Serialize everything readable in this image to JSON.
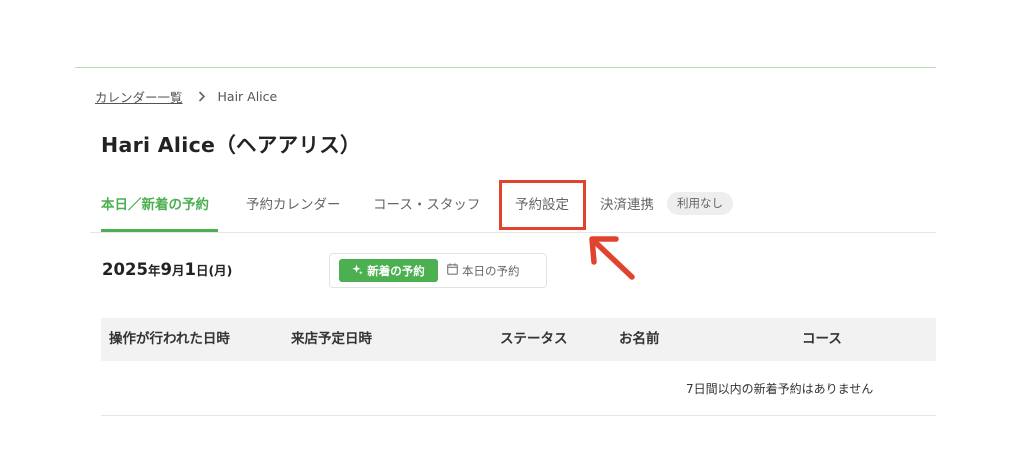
{
  "breadcrumb": {
    "link": "カレンダー一覧",
    "current": "Hair Alice"
  },
  "page_title": "Hari Alice（ヘアアリス）",
  "tabs": [
    {
      "label": "本日／新着の予約",
      "active": true
    },
    {
      "label": "予約カレンダー",
      "active": false
    },
    {
      "label": "コース・スタッフ",
      "active": false
    },
    {
      "label": "予約設定",
      "active": false,
      "highlighted": true
    },
    {
      "label": "決済連携",
      "active": false
    }
  ],
  "payment_badge": "利用なし",
  "date": {
    "year": "2025",
    "year_suffix": "年",
    "month": "9",
    "month_suffix": "月",
    "day": "1",
    "day_suffix": "日",
    "weekday": "(月)"
  },
  "view_toggle": {
    "new_label": "新着の予約",
    "today_label": "本日の予約",
    "selected": "new"
  },
  "table": {
    "columns": [
      "操作が行われた日時",
      "来店予定日時",
      "ステータス",
      "お名前",
      "コース"
    ],
    "rows": [],
    "empty_message": "7日間以内の新着予約はありません"
  },
  "colors": {
    "accent": "#4caf50",
    "highlight": "#e0442f"
  },
  "icons": {
    "breadcrumb_separator": "chevron-right-icon",
    "new_reservations": "sparkle-icon",
    "today_reservations": "calendar-icon"
  }
}
